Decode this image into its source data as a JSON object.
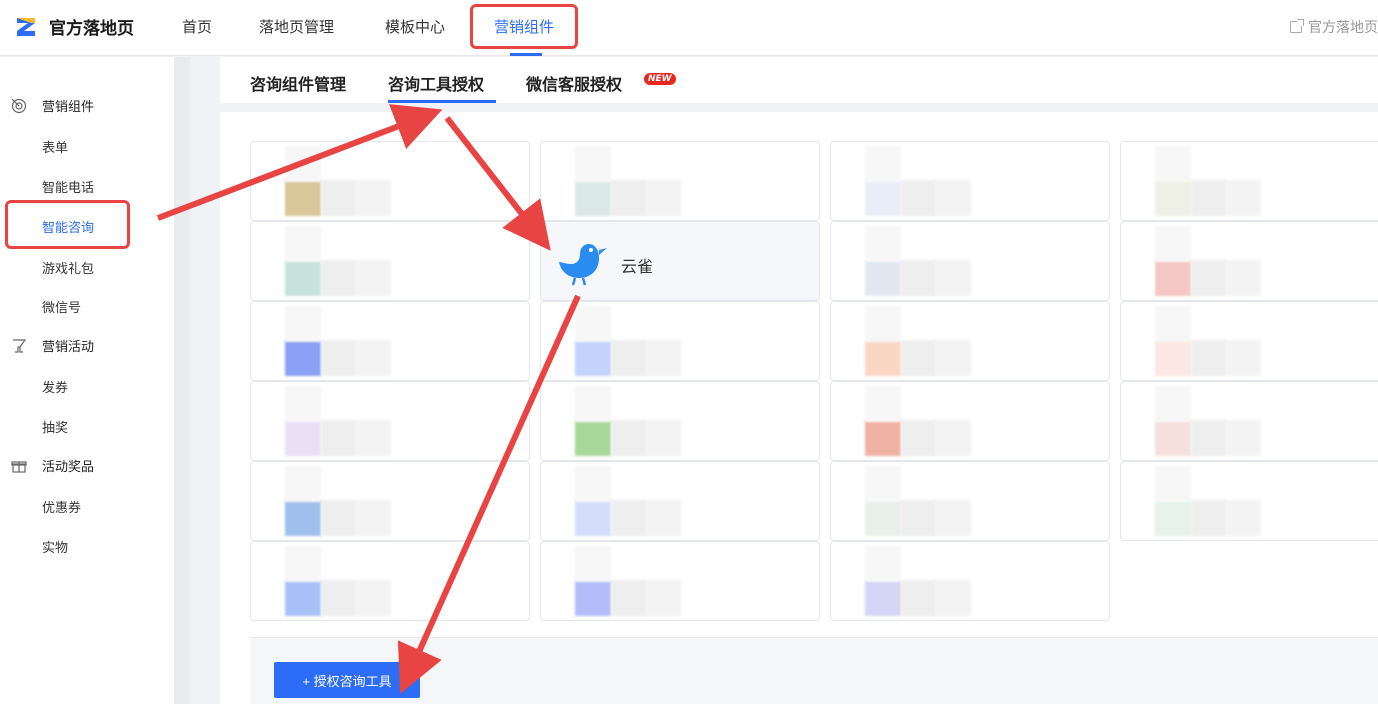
{
  "app": {
    "logo_text": "官方落地页",
    "logo_icon": "logo-icon"
  },
  "nav": {
    "items": [
      {
        "label": "首页",
        "active": false
      },
      {
        "label": "落地页管理",
        "active": false
      },
      {
        "label": "模板中心",
        "active": false
      },
      {
        "label": "营销组件",
        "active": true
      }
    ],
    "right_link": "官方落地页"
  },
  "sidebar": {
    "groups": [
      {
        "label": "营销组件",
        "icon": "target-icon",
        "items": [
          "表单",
          "智能电话",
          "智能咨询",
          "游戏礼包",
          "微信号"
        ]
      },
      {
        "label": "营销活动",
        "icon": "cup-icon",
        "items": [
          "发券",
          "抽奖"
        ]
      },
      {
        "label": "活动奖品",
        "icon": "gift-icon",
        "items": [
          "优惠券",
          "实物"
        ]
      }
    ],
    "active_item": "智能咨询"
  },
  "subtabs": {
    "items": [
      {
        "label": "咨询组件管理"
      },
      {
        "label": "咨询工具授权"
      },
      {
        "label": "微信客服授权"
      }
    ],
    "active": "咨询工具授权",
    "new_badge": "NEW"
  },
  "tools": {
    "visible_tool_name": "云雀",
    "visible_tool_icon": "bird-icon"
  },
  "footer": {
    "auth_button_label": "+ 授权咨询工具"
  },
  "colors": {
    "accent": "#2d6cf6",
    "annotation": "#e84444"
  }
}
